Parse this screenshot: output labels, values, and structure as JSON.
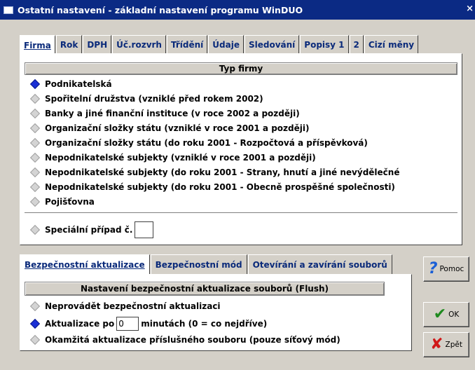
{
  "window": {
    "title": "Ostatní nastavení - základní nastavení programu WinDUO",
    "close_glyph": "×"
  },
  "tabs": [
    {
      "label": "Firma"
    },
    {
      "label": "Rok"
    },
    {
      "label": "DPH"
    },
    {
      "label": "Úč.rozvrh"
    },
    {
      "label": "Třídění"
    },
    {
      "label": "Údaje"
    },
    {
      "label": "Sledování"
    },
    {
      "label": "Popisy 1"
    },
    {
      "label": "2"
    },
    {
      "label": "Cizí měny"
    }
  ],
  "firm_type": {
    "header": "Typ firmy",
    "options": [
      {
        "label": "Podnikatelská",
        "selected": true
      },
      {
        "label": "Spořitelní družstva (vzniklé před rokem 2002)",
        "selected": false
      },
      {
        "label": "Banky a jiné finanční instituce (v roce 2002 a později)",
        "selected": false
      },
      {
        "label": "Organizační složky státu (vzniklé v roce 2001 a později)",
        "selected": false
      },
      {
        "label": "Organizační složky státu (do roku 2001 - Rozpočtová a příspěvková)",
        "selected": false
      },
      {
        "label": "Nepodnikatelské subjekty (vzniklé v roce 2001 a později)",
        "selected": false
      },
      {
        "label": "Nepodnikatelské subjekty (do roku 2001 - Strany, hnutí a jiné nevýdělečné",
        "selected": false
      },
      {
        "label": "Nepodnikatelské subjekty (do roku 2001 - Obecně prospěšné společnosti)",
        "selected": false
      },
      {
        "label": "Pojišťovna",
        "selected": false
      }
    ],
    "special_label": "Speciální případ č.",
    "special_value": ""
  },
  "bottom_tabs": [
    {
      "label": "Bezpečnostní aktualizace"
    },
    {
      "label": "Bezpečnostní mód"
    },
    {
      "label": "Otevírání a zavírání souborů"
    }
  ],
  "flush": {
    "header": "Nastavení bezpečnostní aktualizace souborů (Flush)",
    "opt_none": "Neprovádět bezpečnostní aktualizaci",
    "opt_every_prefix": "Aktualizace po",
    "opt_every_value": "0",
    "opt_every_suffix": "minutách (0 = co nejdříve)",
    "opt_immediate": "Okamžitá aktualizace příslušného souboru (pouze síťový mód)"
  },
  "buttons": {
    "help": "Pomoc",
    "ok": "OK",
    "back": "Zpět"
  },
  "colors": {
    "titlebar": "#0b2a84",
    "tab_text": "#0a2a7a",
    "radio_on": "#1a2fd6",
    "ok_icon": "#1f8a1f",
    "back_icon": "#d01818",
    "help_icon": "#1a5fd6"
  }
}
